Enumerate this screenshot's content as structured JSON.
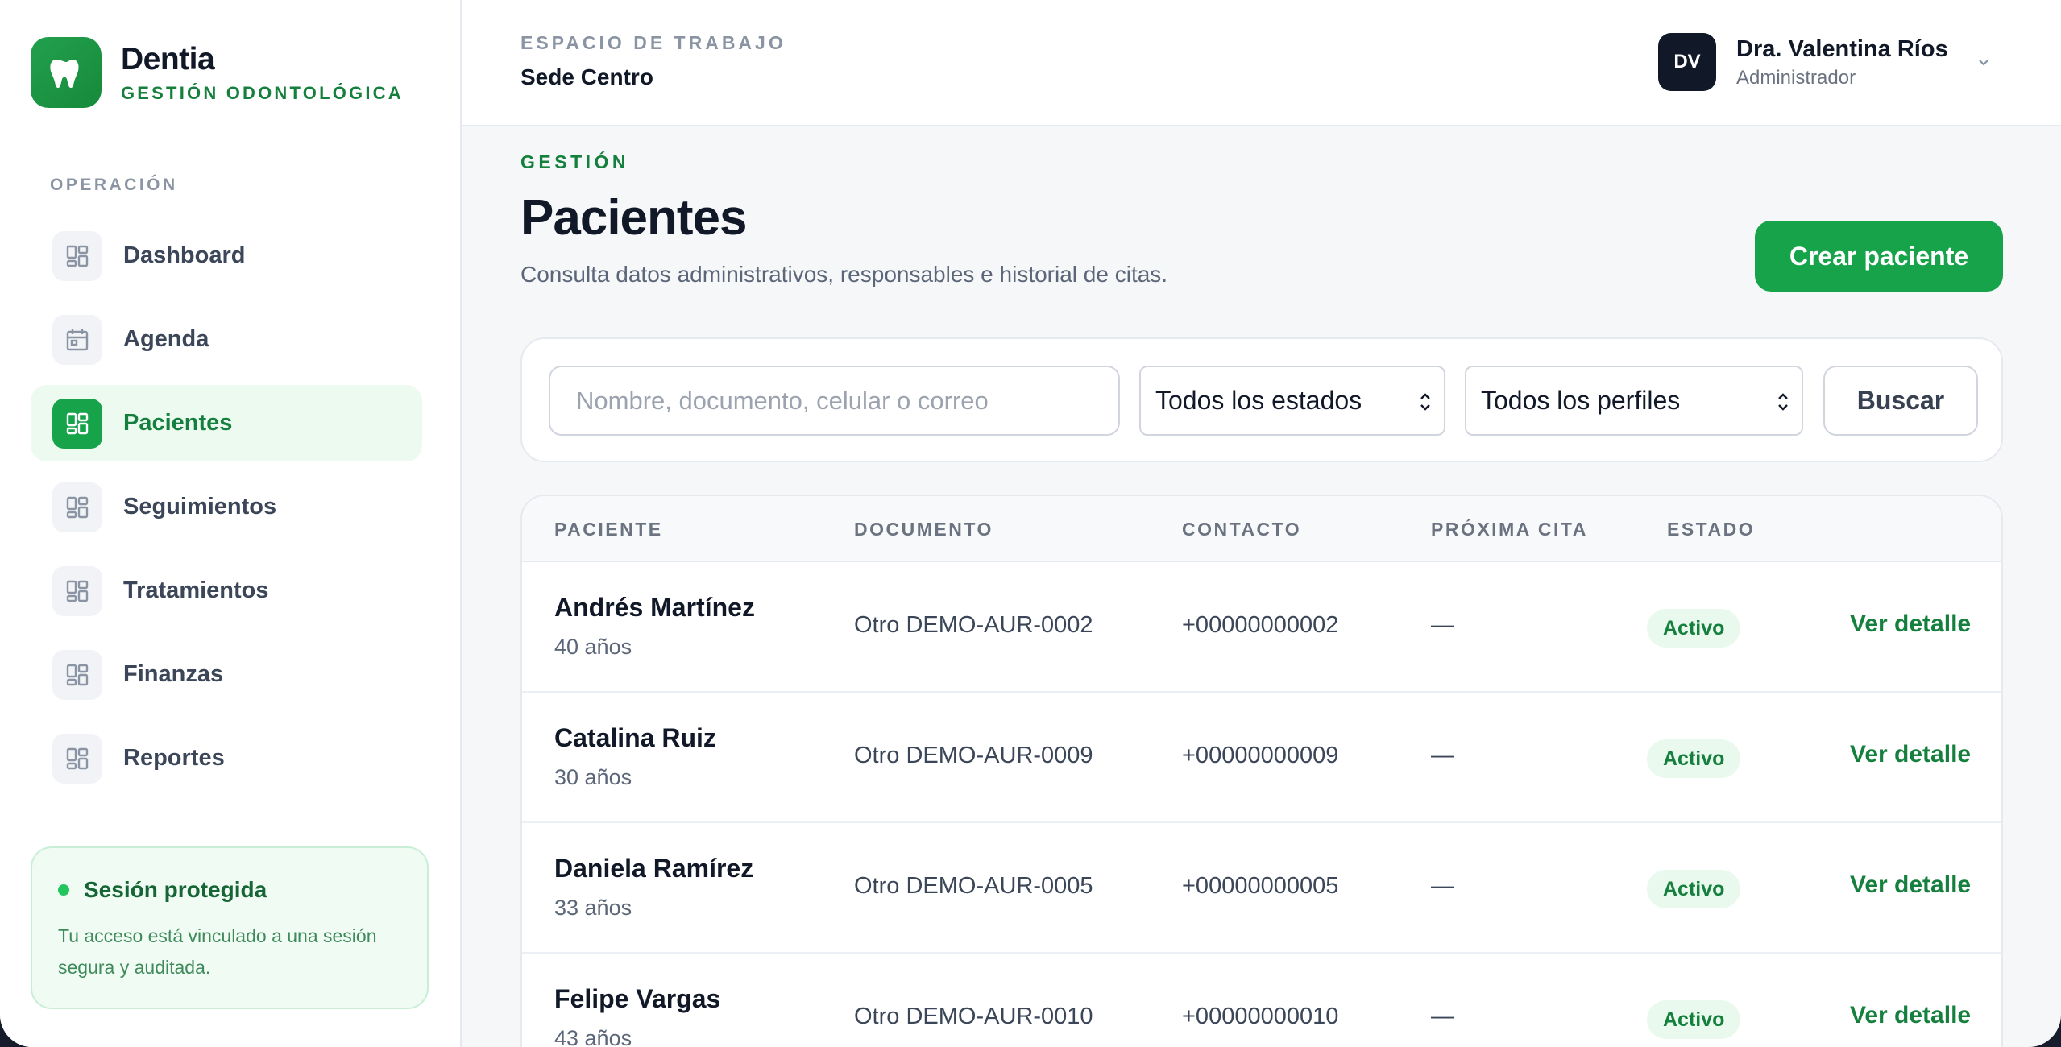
{
  "brand": {
    "name": "Dentia",
    "subtitle": "GESTIÓN ODONTOLÓGICA"
  },
  "sidebar": {
    "section_label": "OPERACIÓN",
    "items": [
      {
        "label": "Dashboard",
        "icon": "dashboard-icon"
      },
      {
        "label": "Agenda",
        "icon": "calendar-icon"
      },
      {
        "label": "Pacientes",
        "icon": "dashboard-icon",
        "active": true
      },
      {
        "label": "Seguimientos",
        "icon": "dashboard-icon"
      },
      {
        "label": "Tratamientos",
        "icon": "dashboard-icon"
      },
      {
        "label": "Finanzas",
        "icon": "dashboard-icon"
      },
      {
        "label": "Reportes",
        "icon": "dashboard-icon"
      }
    ],
    "secure_card": {
      "title": "Sesión protegida",
      "description": "Tu acceso está vinculado a una sesión segura y auditada."
    }
  },
  "topbar": {
    "workspace_label": "ESPACIO DE TRABAJO",
    "workspace_name": "Sede Centro",
    "user": {
      "initials": "DV",
      "name": "Dra. Valentina Ríos",
      "role": "Administrador"
    }
  },
  "page": {
    "section_label": "GESTIÓN",
    "title": "Pacientes",
    "subtitle": "Consulta datos administrativos, responsables e historial de citas.",
    "create_button": "Crear paciente"
  },
  "filters": {
    "search_placeholder": "Nombre, documento, celular o correo",
    "search_value": "",
    "status_selected": "Todos los estados",
    "profile_selected": "Todos los perfiles",
    "search_button": "Buscar"
  },
  "table": {
    "columns": [
      "PACIENTE",
      "DOCUMENTO",
      "CONTACTO",
      "PRÓXIMA CITA",
      "ESTADO"
    ],
    "rows": [
      {
        "name": "Andrés Martínez",
        "age": "40 años",
        "document": "Otro DEMO-AUR-0002",
        "contact": "+00000000002",
        "next_appointment": "—",
        "status": "Activo",
        "action": "Ver detalle"
      },
      {
        "name": "Catalina Ruiz",
        "age": "30 años",
        "document": "Otro DEMO-AUR-0009",
        "contact": "+00000000009",
        "next_appointment": "—",
        "status": "Activo",
        "action": "Ver detalle"
      },
      {
        "name": "Daniela Ramírez",
        "age": "33 años",
        "document": "Otro DEMO-AUR-0005",
        "contact": "+00000000005",
        "next_appointment": "—",
        "status": "Activo",
        "action": "Ver detalle"
      },
      {
        "name": "Felipe Vargas",
        "age": "43 años",
        "document": "Otro DEMO-AUR-0010",
        "contact": "+00000000010",
        "next_appointment": "—",
        "status": "Activo",
        "action": "Ver detalle"
      }
    ]
  },
  "colors": {
    "brand_green": "#16a34a",
    "active_bg": "#ecfaf0",
    "text_dark": "#111827"
  }
}
